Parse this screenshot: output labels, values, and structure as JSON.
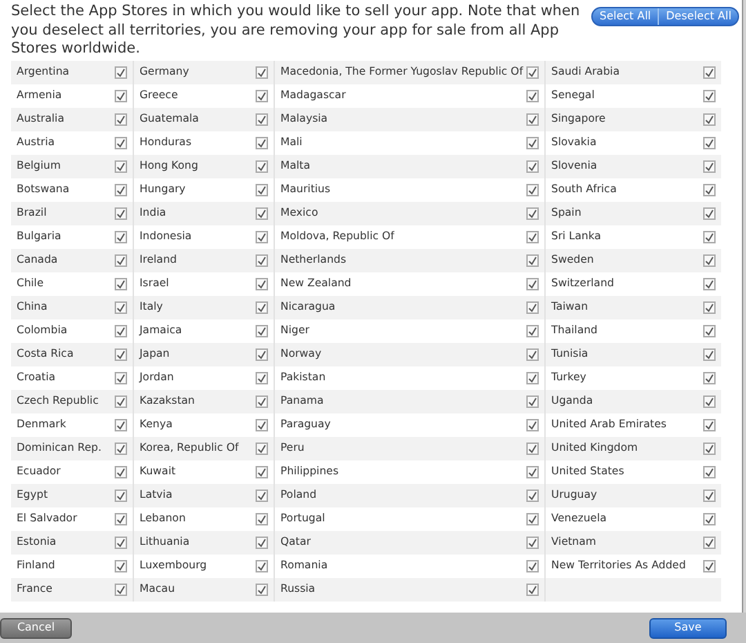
{
  "instructions": "Select the App Stores in which you would like to sell your app. Note that when you deselect all territories, you are removing your app for sale from all App Stores worldwide.",
  "header_buttons": [
    "Select All",
    "Deselect All"
  ],
  "columns": [
    [
      {
        "name": "Argentina",
        "checked": true
      },
      {
        "name": "Armenia",
        "checked": true
      },
      {
        "name": "Australia",
        "checked": true
      },
      {
        "name": "Austria",
        "checked": true
      },
      {
        "name": "Belgium",
        "checked": true
      },
      {
        "name": "Botswana",
        "checked": true
      },
      {
        "name": "Brazil",
        "checked": true
      },
      {
        "name": "Bulgaria",
        "checked": true
      },
      {
        "name": "Canada",
        "checked": true
      },
      {
        "name": "Chile",
        "checked": true
      },
      {
        "name": "China",
        "checked": true
      },
      {
        "name": "Colombia",
        "checked": true
      },
      {
        "name": "Costa Rica",
        "checked": true
      },
      {
        "name": "Croatia",
        "checked": true
      },
      {
        "name": "Czech Republic",
        "checked": true
      },
      {
        "name": "Denmark",
        "checked": true
      },
      {
        "name": "Dominican Rep.",
        "checked": true
      },
      {
        "name": "Ecuador",
        "checked": true
      },
      {
        "name": "Egypt",
        "checked": true
      },
      {
        "name": "El Salvador",
        "checked": true
      },
      {
        "name": "Estonia",
        "checked": true
      },
      {
        "name": "Finland",
        "checked": true
      },
      {
        "name": "France",
        "checked": true
      }
    ],
    [
      {
        "name": "Germany",
        "checked": true
      },
      {
        "name": "Greece",
        "checked": true
      },
      {
        "name": "Guatemala",
        "checked": true
      },
      {
        "name": "Honduras",
        "checked": true
      },
      {
        "name": "Hong Kong",
        "checked": true
      },
      {
        "name": "Hungary",
        "checked": true
      },
      {
        "name": "India",
        "checked": true
      },
      {
        "name": "Indonesia",
        "checked": true
      },
      {
        "name": "Ireland",
        "checked": true
      },
      {
        "name": "Israel",
        "checked": true
      },
      {
        "name": "Italy",
        "checked": true
      },
      {
        "name": "Jamaica",
        "checked": true
      },
      {
        "name": "Japan",
        "checked": true
      },
      {
        "name": "Jordan",
        "checked": true
      },
      {
        "name": "Kazakstan",
        "checked": true
      },
      {
        "name": "Kenya",
        "checked": true
      },
      {
        "name": "Korea, Republic Of",
        "checked": true
      },
      {
        "name": "Kuwait",
        "checked": true
      },
      {
        "name": "Latvia",
        "checked": true
      },
      {
        "name": "Lebanon",
        "checked": true
      },
      {
        "name": "Lithuania",
        "checked": true
      },
      {
        "name": "Luxembourg",
        "checked": true
      },
      {
        "name": "Macau",
        "checked": true
      }
    ],
    [
      {
        "name": "Macedonia, The Former Yugoslav Republic Of",
        "checked": true
      },
      {
        "name": "Madagascar",
        "checked": true
      },
      {
        "name": "Malaysia",
        "checked": true
      },
      {
        "name": "Mali",
        "checked": true
      },
      {
        "name": "Malta",
        "checked": true
      },
      {
        "name": "Mauritius",
        "checked": true
      },
      {
        "name": "Mexico",
        "checked": true
      },
      {
        "name": "Moldova, Republic Of",
        "checked": true
      },
      {
        "name": "Netherlands",
        "checked": true
      },
      {
        "name": "New Zealand",
        "checked": true
      },
      {
        "name": "Nicaragua",
        "checked": true
      },
      {
        "name": "Niger",
        "checked": true
      },
      {
        "name": "Norway",
        "checked": true
      },
      {
        "name": "Pakistan",
        "checked": true
      },
      {
        "name": "Panama",
        "checked": true
      },
      {
        "name": "Paraguay",
        "checked": true
      },
      {
        "name": "Peru",
        "checked": true
      },
      {
        "name": "Philippines",
        "checked": true
      },
      {
        "name": "Poland",
        "checked": true
      },
      {
        "name": "Portugal",
        "checked": true
      },
      {
        "name": "Qatar",
        "checked": true
      },
      {
        "name": "Romania",
        "checked": true
      },
      {
        "name": "Russia",
        "checked": true
      }
    ],
    [
      {
        "name": "Saudi Arabia",
        "checked": true
      },
      {
        "name": "Senegal",
        "checked": true
      },
      {
        "name": "Singapore",
        "checked": true
      },
      {
        "name": "Slovakia",
        "checked": true
      },
      {
        "name": "Slovenia",
        "checked": true
      },
      {
        "name": "South Africa",
        "checked": true
      },
      {
        "name": "Spain",
        "checked": true
      },
      {
        "name": "Sri Lanka",
        "checked": true
      },
      {
        "name": "Sweden",
        "checked": true
      },
      {
        "name": "Switzerland",
        "checked": true
      },
      {
        "name": "Taiwan",
        "checked": true
      },
      {
        "name": "Thailand",
        "checked": true
      },
      {
        "name": "Tunisia",
        "checked": true
      },
      {
        "name": "Turkey",
        "checked": true
      },
      {
        "name": "Uganda",
        "checked": true
      },
      {
        "name": "United Arab Emirates",
        "checked": true
      },
      {
        "name": "United Kingdom",
        "checked": true
      },
      {
        "name": "United States",
        "checked": true
      },
      {
        "name": "Uruguay",
        "checked": true
      },
      {
        "name": "Venezuela",
        "checked": true
      },
      {
        "name": "Vietnam",
        "checked": true
      },
      {
        "name": "New Territories As Added",
        "checked": true
      }
    ]
  ],
  "footer_buttons": [
    {
      "label": "Cancel",
      "kind": "secondary"
    },
    {
      "label": "Save",
      "kind": "primary"
    }
  ]
}
